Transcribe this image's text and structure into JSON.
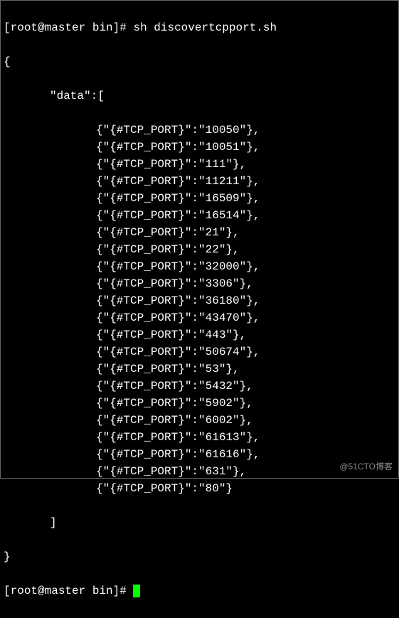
{
  "prompt_user": "root",
  "prompt_host": "master",
  "prompt_path": "bin",
  "command": "sh discovertcpport.sh",
  "open_brace": "{",
  "data_key_line": "\"data\":[",
  "entries": [
    "{\"{#TCP_PORT}\":\"10050\"},",
    "{\"{#TCP_PORT}\":\"10051\"},",
    "{\"{#TCP_PORT}\":\"111\"},",
    "{\"{#TCP_PORT}\":\"11211\"},",
    "{\"{#TCP_PORT}\":\"16509\"},",
    "{\"{#TCP_PORT}\":\"16514\"},",
    "{\"{#TCP_PORT}\":\"21\"},",
    "{\"{#TCP_PORT}\":\"22\"},",
    "{\"{#TCP_PORT}\":\"32000\"},",
    "{\"{#TCP_PORT}\":\"3306\"},",
    "{\"{#TCP_PORT}\":\"36180\"},",
    "{\"{#TCP_PORT}\":\"43470\"},",
    "{\"{#TCP_PORT}\":\"443\"},",
    "{\"{#TCP_PORT}\":\"50674\"},",
    "{\"{#TCP_PORT}\":\"53\"},",
    "{\"{#TCP_PORT}\":\"5432\"},",
    "{\"{#TCP_PORT}\":\"5902\"},",
    "{\"{#TCP_PORT}\":\"6002\"},",
    "{\"{#TCP_PORT}\":\"61613\"},",
    "{\"{#TCP_PORT}\":\"61616\"},",
    "{\"{#TCP_PORT}\":\"631\"},",
    "{\"{#TCP_PORT}\":\"80\"}"
  ],
  "close_bracket": "]",
  "close_brace": "}",
  "watermark": "@51CTO博客"
}
